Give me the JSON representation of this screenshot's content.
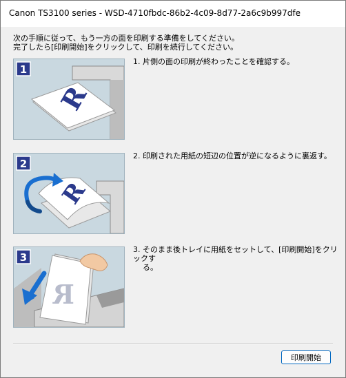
{
  "window": {
    "title": "Canon TS3100 series - WSD-4710fbdc-86b2-4c09-8d77-2a6c9b997dfe"
  },
  "instructions": {
    "line1": "次の手順に従って、もう一方の面を印刷する準備をしてください。",
    "line2": "完了したら[印刷開始]をクリックして、印刷を続行してください。"
  },
  "steps": [
    {
      "number": "1",
      "text": "1.  片側の面の印刷が終わったことを確認する。"
    },
    {
      "number": "2",
      "text": "2.  印刷された用紙の短辺の位置が逆になるように裏返す。"
    },
    {
      "number": "3",
      "text_line1": "3.  そのまま後トレイに用紙をセットして、[印刷開始]をクリックす",
      "text_line2": "る。"
    }
  ],
  "buttons": {
    "start_print": "印刷開始"
  },
  "colors": {
    "panel_bg": "#c9d8e0",
    "badge": "#2b3a8c",
    "arrow": "#1a6fd0",
    "letter": "#2b3a8c"
  },
  "icons": {
    "badge": "step-number-badge",
    "arrow_rotate": "rotate-arrow-icon",
    "arrow_down": "down-arrow-icon"
  }
}
